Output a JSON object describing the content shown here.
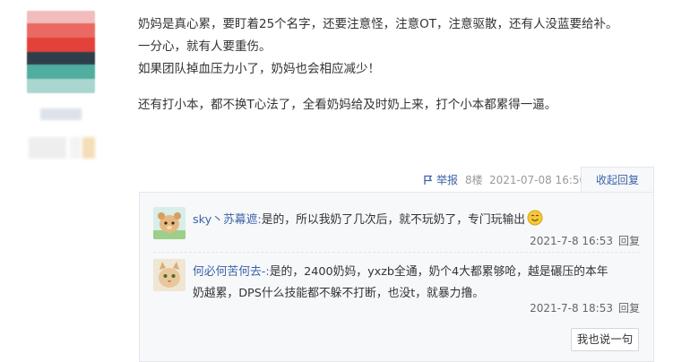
{
  "post": {
    "lines": [
      "奶妈是真心累，要盯着25个名字，还要注意怪，注意OT，注意驱散，还有人没蓝要给补。",
      "一分心，就有人要重伤。",
      "如果团队掉血压力小了，奶妈也会相应减少！",
      "还有打小本，都不换T心法了，全看奶妈给及时奶上来，打个小本都累得一逼。"
    ],
    "report_label": "举报",
    "floor": "8楼",
    "time": "2021-07-08 16:50",
    "collapse_label": "收起回复"
  },
  "replies": [
    {
      "user": "sky丶苏幕遮:",
      "text": "是的，所以我奶了几次后，就不玩奶了，专门玩输出",
      "emoji": "smile-emoji",
      "time": "2021-7-8 16:53",
      "reply_label": "回复"
    },
    {
      "user": "何必何苦何去-:",
      "text_line1": "是的，2400奶妈，yxzb全通，奶个4大都累够呛，越是碾压的本年",
      "text_line2": "奶越累，DPS什么技能都不躲不打断，也没t，就暴力撸。",
      "time": "2021-7-8 18:53",
      "reply_label": "回复"
    }
  ],
  "say_button": "我也说一句",
  "colors": {
    "link": "#3b63a7",
    "panel_bg": "#f7f8fa",
    "border": "#e4e7ed"
  }
}
